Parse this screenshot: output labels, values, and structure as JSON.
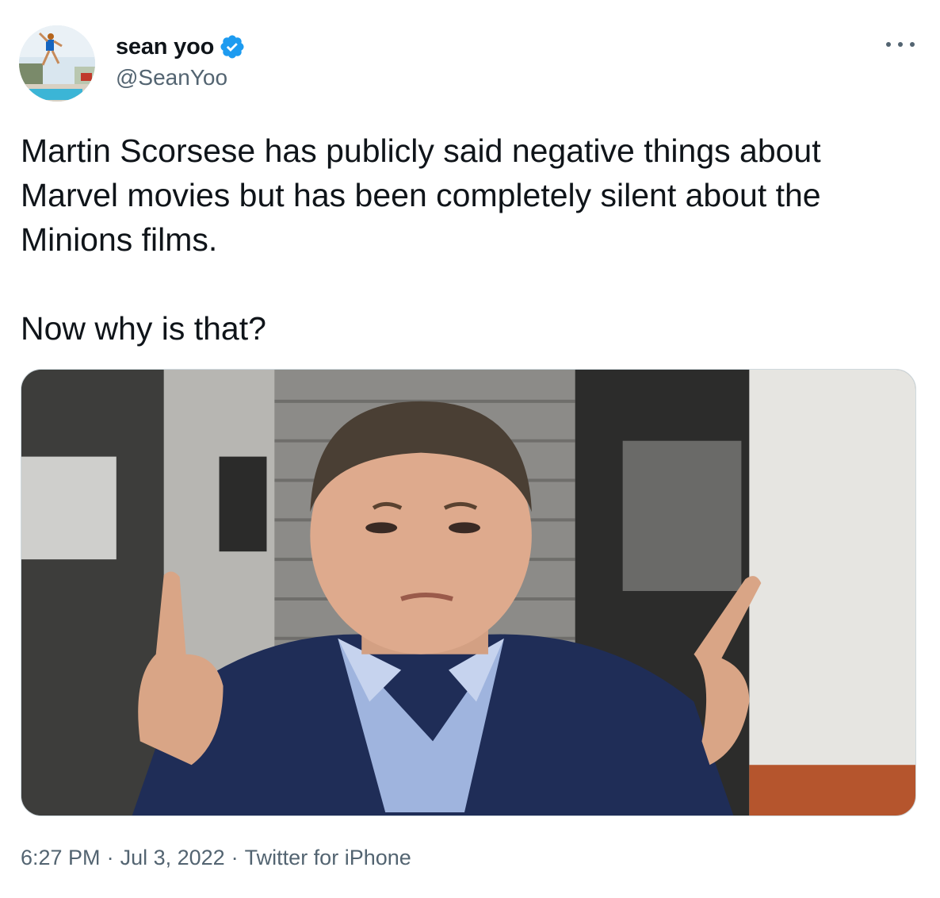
{
  "author": {
    "display_name": "sean yoo",
    "handle": "@SeanYoo",
    "verified": true,
    "avatar_icon": "avatar-photo-pool-jump"
  },
  "tweet": {
    "paragraphs": [
      "Martin Scorsese has publicly said negative things about Marvel movies but has been completely silent about the Minions films.",
      "Now why is that?"
    ],
    "media_icon": "photo-man-pointing-up"
  },
  "meta": {
    "time": "6:27 PM",
    "date": "Jul 3, 2022",
    "source": "Twitter for iPhone",
    "separator": "·"
  },
  "icons": {
    "verified": "verified-badge-icon",
    "more": "more-options-icon"
  },
  "colors": {
    "text_primary": "#0f1419",
    "text_secondary": "#536471",
    "verified_blue": "#1d9bf0",
    "border": "#cfd9de"
  }
}
